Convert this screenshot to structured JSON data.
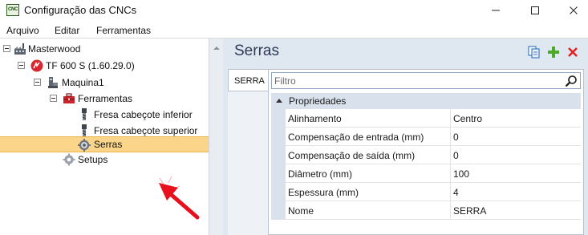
{
  "window": {
    "app_icon_text": "CNC",
    "title": "Configuração das CNCs"
  },
  "menu": {
    "items": [
      "Arquivo",
      "Editar",
      "Ferramentas"
    ]
  },
  "tree": {
    "nodes": [
      {
        "label": "Masterwood",
        "icon": "factory-icon",
        "expanded": true
      },
      {
        "label": "TF 600 S (1.60.29.0)",
        "icon": "machine-brand-icon",
        "expanded": true
      },
      {
        "label": "Maquina1",
        "icon": "machine-icon",
        "expanded": true
      },
      {
        "label": "Ferramentas",
        "icon": "toolbox-icon",
        "expanded": true
      },
      {
        "label": "Fresa cabeçote inferior",
        "icon": "drill-bit-icon"
      },
      {
        "label": "Fresa cabeçote superior",
        "icon": "drill-bit-icon"
      },
      {
        "label": "Serras",
        "icon": "saw-gear-icon",
        "selected": true
      },
      {
        "label": "Setups",
        "icon": "gear-icon"
      }
    ]
  },
  "detail": {
    "title": "Serras",
    "actions": [
      "copy-icon",
      "add-icon",
      "delete-icon"
    ],
    "tab": "SERRA",
    "filter_placeholder": "Filtro",
    "group": "Propriedades",
    "properties": [
      {
        "name": "Alinhamento",
        "value": "Centro"
      },
      {
        "name": "Compensação de entrada (mm)",
        "value": "0"
      },
      {
        "name": "Compensação de saída (mm)",
        "value": "0"
      },
      {
        "name": "Diâmetro (mm)",
        "value": "100"
      },
      {
        "name": "Espessura (mm)",
        "value": "4"
      },
      {
        "name": "Nome",
        "value": "SERRA"
      }
    ]
  },
  "colors": {
    "selection": "#fbd58a",
    "detail_background": "#dfe7f1",
    "annotation_arrow": "#e8101c"
  }
}
